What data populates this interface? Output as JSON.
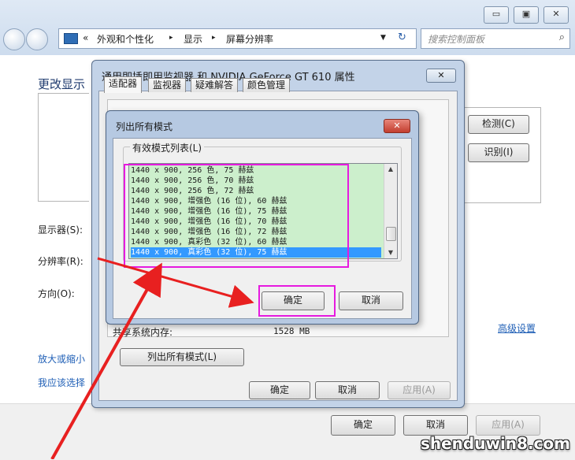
{
  "window": {
    "breadcrumb": [
      "«",
      "外观和个性化",
      "▸",
      "显示",
      "▸",
      "屏幕分辨率"
    ],
    "search_placeholder": "搜索控制面板",
    "caption_buttons": [
      "▭",
      "▣",
      "✕"
    ],
    "heading": "更改显示",
    "detect_button": "检测(C)",
    "identify_button": "识别(I)",
    "labels": {
      "display": "显示器(S):",
      "resolution": "分辨率(R):",
      "orientation": "方向(O):"
    },
    "advanced_link": "高级设置",
    "links": [
      "放大或缩小",
      "我应该选择"
    ],
    "ok": "确定",
    "cancel": "取消",
    "apply": "应用(A)"
  },
  "properties_dialog": {
    "title": "通用即插即用监视器 和 NVIDIA GeForce GT 610 属性",
    "close": "✕",
    "tabs": [
      "适配器",
      "监视器",
      "疑难解答",
      "颜色管理"
    ],
    "shared_memory_label": "共享系统内存:",
    "shared_memory_value": "1528 MB",
    "list_modes_button": "列出所有模式(L)",
    "ok": "确定",
    "cancel": "取消",
    "apply": "应用(A)"
  },
  "modes_dialog": {
    "title": "列出所有模式",
    "close": "✕",
    "group_label": "有效模式列表(L)",
    "modes": [
      "1440 x 900, 256 色, 75 赫兹",
      "1440 x 900, 256 色, 70 赫兹",
      "1440 x 900, 256 色, 72 赫兹",
      "1440 x 900, 增强色 (16 位), 60 赫兹",
      "1440 x 900, 增强色 (16 位), 75 赫兹",
      "1440 x 900, 增强色 (16 位), 70 赫兹",
      "1440 x 900, 增强色 (16 位), 72 赫兹",
      "1440 x 900, 真彩色 (32 位), 60 赫兹",
      "1440 x 900, 真彩色 (32 位), 75 赫兹"
    ],
    "selected_index": 8,
    "ok": "确定",
    "cancel": "取消"
  },
  "watermark": "shenduwin8.com",
  "colors": {
    "highlight": "#e61adf",
    "arrow": "#e82020",
    "selection": "#3399ff",
    "list_bg": "#ccefcc"
  }
}
